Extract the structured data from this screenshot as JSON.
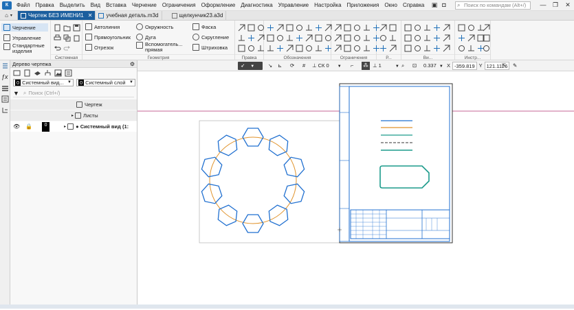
{
  "menubar": {
    "items": [
      "Файл",
      "Правка",
      "Выделить",
      "Вид",
      "Вставка",
      "Черчение",
      "Ограничения",
      "Оформление",
      "Диагностика",
      "Управление",
      "Настройка",
      "Приложения",
      "Окно",
      "Справка"
    ],
    "search_placeholder": "Поиск по командам (Alt+/)"
  },
  "tabs": [
    {
      "label": "Чертеж БЕЗ ИМЕНИ1",
      "active": true
    },
    {
      "label": "учебная деталь.m3d",
      "active": false
    },
    {
      "label": "щелкунчик23.a3d",
      "active": false
    }
  ],
  "ribbon": {
    "left_items": [
      "Черчение",
      "Управление",
      "Стандартные",
      "изделия"
    ],
    "group_system_label": "Системная",
    "geometry": {
      "col1": [
        "Автолиния",
        "Прямоугольник",
        "Отрезок"
      ],
      "col2": [
        "Окружность",
        "Дуга",
        "Вспомогатель...",
        "прямая"
      ],
      "col3": [
        "Фаска",
        "Скругление",
        "Штриховка"
      ],
      "label": "Геометрия"
    },
    "group_labels": [
      "Правка",
      "Обозначения",
      "Ограничения",
      "Р...",
      "Ви...",
      "Инстр..."
    ]
  },
  "panel": {
    "title": "Дерево чертежа",
    "view_number": "0",
    "view_select": "Системный вид...",
    "layer_number": "0",
    "layer_select": "Системный слой",
    "search_placeholder": "Поиск (Ctrl+/)",
    "tree": [
      {
        "label": "Чертеж"
      },
      {
        "label": "Листы"
      },
      {
        "label": "Системный вид (1:"
      }
    ],
    "row_number": "0"
  },
  "viewbar": {
    "cs": "СК 0",
    "scale": "1",
    "zoom": "0.337",
    "x_label": "X",
    "x_value": "-359.819",
    "y_label": "Y",
    "y_value": "121.1126"
  },
  "colors": {
    "accent": "#1b5e9e",
    "hexagon": "#1f6fd0",
    "circle": "#e0922a",
    "sheet_line": "#1f6fd0",
    "teal": "#1a9a8a",
    "magenta_line": "#b03070"
  }
}
